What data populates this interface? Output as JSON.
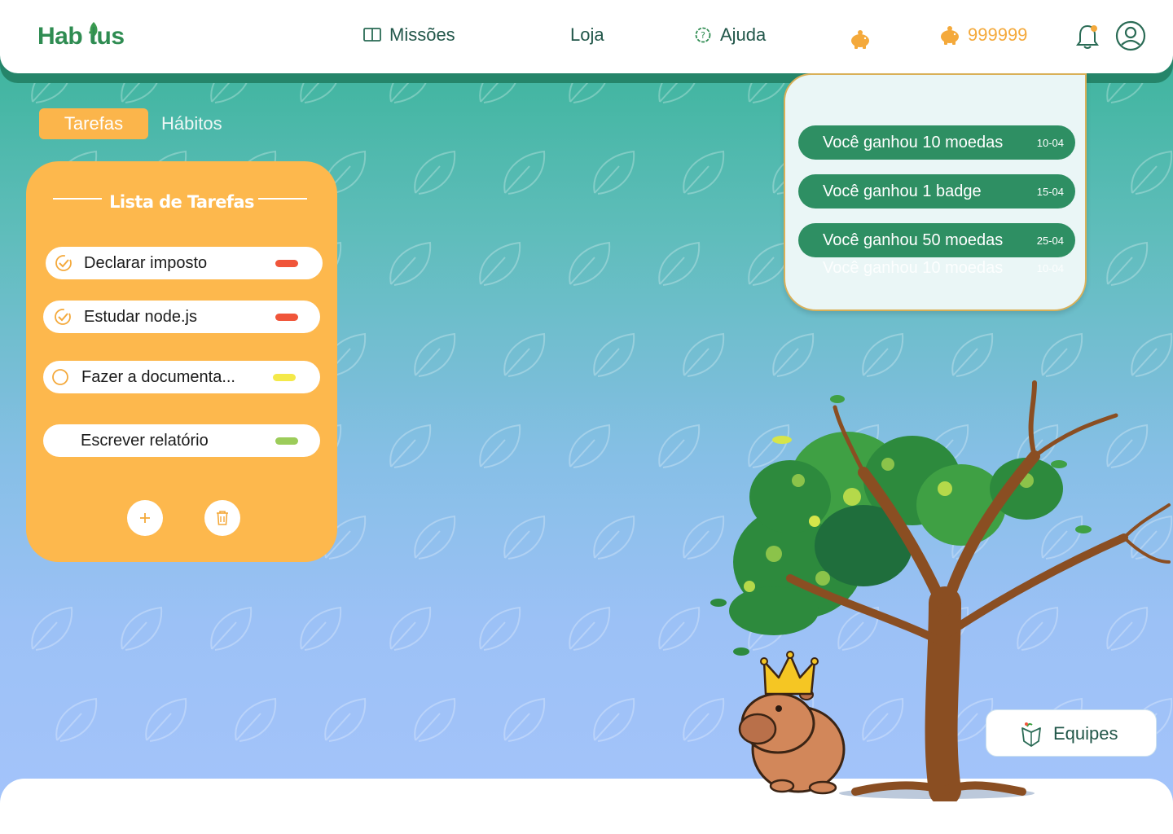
{
  "app": {
    "logo_text": "Hab tus"
  },
  "header": {
    "nav": [
      {
        "label": "Missões",
        "icon": "book-icon"
      },
      {
        "label": "Loja",
        "icon": ""
      },
      {
        "label": "Ajuda",
        "icon": "help-icon"
      }
    ],
    "coin_count": "999999"
  },
  "tabs": [
    {
      "label": "Tarefas",
      "active": true
    },
    {
      "label": "Hábitos",
      "active": false
    }
  ],
  "task_list": {
    "title": "Lista de Tarefas",
    "tasks": [
      {
        "label": "Declarar imposto",
        "done": true,
        "priority_color": "#f0553a"
      },
      {
        "label": "Estudar node.js",
        "done": true,
        "priority_color": "#f0553a"
      },
      {
        "label": "Fazer a documenta...",
        "done": false,
        "priority_color": "#f4e94a"
      },
      {
        "label": "Escrever relatório",
        "done": false,
        "priority_color": "#9ccc5a"
      }
    ]
  },
  "notifications": [
    {
      "text": "Você ganhou 10 moedas",
      "date": "10-04"
    },
    {
      "text": "Você ganhou 1 badge",
      "date": "15-04"
    },
    {
      "text": "Você ganhou 50 moedas",
      "date": "25-04"
    },
    {
      "text": "Você ganhou 10 moedas",
      "date": "10-04"
    }
  ],
  "equipes_label": "Equipes",
  "colors": {
    "accent_orange": "#fdb84d",
    "brand_green": "#2e8f63",
    "coin_orange": "#f4a93b"
  }
}
